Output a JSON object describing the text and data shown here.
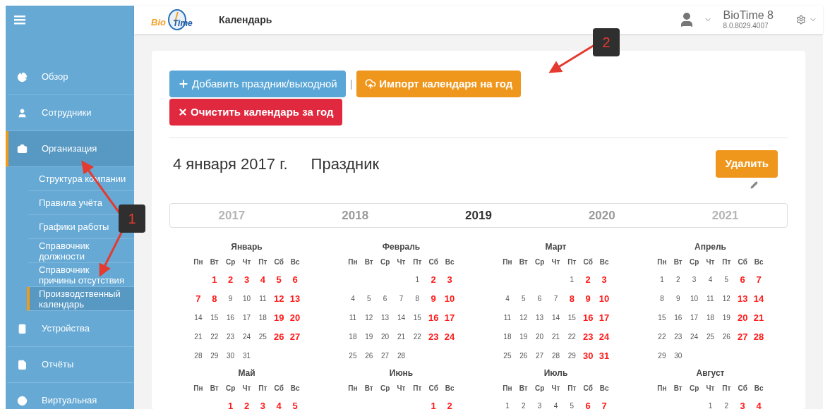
{
  "sidebar": {
    "items": [
      {
        "label": "Обзор",
        "selected": false
      },
      {
        "label": "Сотрудники",
        "selected": false
      },
      {
        "label": "Организация",
        "selected": true,
        "children": [
          {
            "label": "Структура компании",
            "selected": false
          },
          {
            "label": "Правила учёта",
            "selected": false
          },
          {
            "label": "Графики работы",
            "selected": false
          },
          {
            "label": "Справочник должности",
            "selected": false
          },
          {
            "label": "Справочник причины отсутствия",
            "selected": false
          },
          {
            "label": "Производственный календарь",
            "selected": true
          }
        ]
      },
      {
        "label": "Устройства",
        "selected": false
      },
      {
        "label": "Отчёты",
        "selected": false
      },
      {
        "label": "Виртуальная",
        "selected": false
      }
    ]
  },
  "header": {
    "logo": {
      "part1": "Bio",
      "part2": "Time"
    },
    "title": "Календарь",
    "product": "BioTime 8",
    "version": "8.0.8029.4007"
  },
  "toolbar": {
    "add_button": "Добавить праздник/выходной",
    "separator": "|",
    "import_button": "Импорт календаря на год",
    "clear_button": "Очистить календарь за год"
  },
  "event": {
    "date": "4 января 2017 г.",
    "type": "Праздник",
    "delete_button": "Удалить"
  },
  "years": [
    {
      "label": "2017",
      "selected": false,
      "faded": true
    },
    {
      "label": "2018",
      "selected": false,
      "faded": false
    },
    {
      "label": "2019",
      "selected": true,
      "faded": false
    },
    {
      "label": "2020",
      "selected": false,
      "faded": false
    },
    {
      "label": "2021",
      "selected": false,
      "faded": true
    }
  ],
  "months": [
    {
      "name": "Январь",
      "weekdays": [
        "Пн",
        "Вт",
        "Ср",
        "Чт",
        "Пт",
        "Сб",
        "Вс"
      ],
      "weeks": [
        [
          {
            "d": "1",
            "holiday": true
          },
          {
            "d": "2",
            "holiday": true
          },
          {
            "d": "3",
            "holiday": true
          },
          {
            "d": "4",
            "holiday": true
          },
          {
            "d": "5",
            "holiday": true
          },
          {
            "d": "6",
            "holiday": true
          }
        ],
        [
          {
            "d": "7",
            "holiday": true
          },
          {
            "d": "8",
            "holiday": true
          },
          {
            "d": "9",
            "holiday": false
          },
          {
            "d": "10",
            "holiday": false
          },
          {
            "d": "11",
            "holiday": false
          },
          {
            "d": "12",
            "holiday": true
          },
          {
            "d": "13",
            "holiday": true
          }
        ],
        [
          {
            "d": "14",
            "holiday": false
          },
          {
            "d": "15",
            "holiday": false
          },
          {
            "d": "16",
            "holiday": false
          },
          {
            "d": "17",
            "holiday": false
          },
          {
            "d": "18",
            "holiday": false
          },
          {
            "d": "19",
            "holiday": true
          },
          {
            "d": "20",
            "holiday": true
          }
        ],
        [
          {
            "d": "21",
            "holiday": false
          },
          {
            "d": "22",
            "holiday": false
          },
          {
            "d": "23",
            "holiday": false
          },
          {
            "d": "24",
            "holiday": false
          },
          {
            "d": "25",
            "holiday": false
          },
          {
            "d": "26",
            "holiday": true
          },
          {
            "d": "27",
            "holiday": true
          }
        ],
        [
          {
            "d": "28",
            "holiday": false
          },
          {
            "d": "29",
            "holiday": false
          },
          {
            "d": "30",
            "holiday": false
          },
          {
            "d": "31",
            "holiday": false
          }
        ]
      ]
    },
    {
      "name": "Февраль",
      "weekdays": [
        "Пн",
        "Вт",
        "Ср",
        "Чт",
        "Пт",
        "Сб",
        "Вс"
      ],
      "weeks": [
        [
          {
            "d": "1",
            "holiday": false
          },
          {
            "d": "2",
            "holiday": true
          },
          {
            "d": "3",
            "holiday": true
          }
        ],
        [
          {
            "d": "4",
            "holiday": false
          },
          {
            "d": "5",
            "holiday": false
          },
          {
            "d": "6",
            "holiday": false
          },
          {
            "d": "7",
            "holiday": false
          },
          {
            "d": "8",
            "holiday": false
          },
          {
            "d": "9",
            "holiday": true
          },
          {
            "d": "10",
            "holiday": true
          }
        ],
        [
          {
            "d": "11",
            "holiday": false
          },
          {
            "d": "12",
            "holiday": false
          },
          {
            "d": "13",
            "holiday": false
          },
          {
            "d": "14",
            "holiday": false
          },
          {
            "d": "15",
            "holiday": false
          },
          {
            "d": "16",
            "holiday": true
          },
          {
            "d": "17",
            "holiday": true
          }
        ],
        [
          {
            "d": "18",
            "holiday": false
          },
          {
            "d": "19",
            "holiday": false
          },
          {
            "d": "20",
            "holiday": false
          },
          {
            "d": "21",
            "holiday": false
          },
          {
            "d": "22",
            "holiday": false
          },
          {
            "d": "23",
            "holiday": true
          },
          {
            "d": "24",
            "holiday": true
          }
        ],
        [
          {
            "d": "25",
            "holiday": false
          },
          {
            "d": "26",
            "holiday": false
          },
          {
            "d": "27",
            "holiday": false
          },
          {
            "d": "28",
            "holiday": false
          }
        ]
      ]
    },
    {
      "name": "Март",
      "weekdays": [
        "Пн",
        "Вт",
        "Ср",
        "Чт",
        "Пт",
        "Сб",
        "Вс"
      ],
      "weeks": [
        [
          {
            "d": "1",
            "holiday": false
          },
          {
            "d": "2",
            "holiday": true
          },
          {
            "d": "3",
            "holiday": true
          }
        ],
        [
          {
            "d": "4",
            "holiday": false
          },
          {
            "d": "5",
            "holiday": false
          },
          {
            "d": "6",
            "holiday": false
          },
          {
            "d": "7",
            "holiday": false
          },
          {
            "d": "8",
            "holiday": true
          },
          {
            "d": "9",
            "holiday": true
          },
          {
            "d": "10",
            "holiday": true
          }
        ],
        [
          {
            "d": "11",
            "holiday": false
          },
          {
            "d": "12",
            "holiday": false
          },
          {
            "d": "13",
            "holiday": false
          },
          {
            "d": "14",
            "holiday": false
          },
          {
            "d": "15",
            "holiday": false
          },
          {
            "d": "16",
            "holiday": true
          },
          {
            "d": "17",
            "holiday": true
          }
        ],
        [
          {
            "d": "18",
            "holiday": false
          },
          {
            "d": "19",
            "holiday": false
          },
          {
            "d": "20",
            "holiday": false
          },
          {
            "d": "21",
            "holiday": false
          },
          {
            "d": "22",
            "holiday": false
          },
          {
            "d": "23",
            "holiday": true
          },
          {
            "d": "24",
            "holiday": true
          }
        ],
        [
          {
            "d": "25",
            "holiday": false
          },
          {
            "d": "26",
            "holiday": false
          },
          {
            "d": "27",
            "holiday": false
          },
          {
            "d": "28",
            "holiday": false
          },
          {
            "d": "29",
            "holiday": false
          },
          {
            "d": "30",
            "holiday": true
          },
          {
            "d": "31",
            "holiday": true
          }
        ]
      ]
    },
    {
      "name": "Апрель",
      "weekdays": [
        "Пн",
        "Вт",
        "Ср",
        "Чт",
        "Пт",
        "Сб",
        "Вс"
      ],
      "weeks": [
        [
          {
            "d": "1",
            "holiday": false
          },
          {
            "d": "2",
            "holiday": false
          },
          {
            "d": "3",
            "holiday": false
          },
          {
            "d": "4",
            "holiday": false
          },
          {
            "d": "5",
            "holiday": false
          },
          {
            "d": "6",
            "holiday": true
          },
          {
            "d": "7",
            "holiday": true
          }
        ],
        [
          {
            "d": "8",
            "holiday": false
          },
          {
            "d": "9",
            "holiday": false
          },
          {
            "d": "10",
            "holiday": false
          },
          {
            "d": "11",
            "holiday": false
          },
          {
            "d": "12",
            "holiday": false
          },
          {
            "d": "13",
            "holiday": true
          },
          {
            "d": "14",
            "holiday": true
          }
        ],
        [
          {
            "d": "15",
            "holiday": false
          },
          {
            "d": "16",
            "holiday": false
          },
          {
            "d": "17",
            "holiday": false
          },
          {
            "d": "18",
            "holiday": false
          },
          {
            "d": "19",
            "holiday": false
          },
          {
            "d": "20",
            "holiday": true
          },
          {
            "d": "21",
            "holiday": true
          }
        ],
        [
          {
            "d": "22",
            "holiday": false
          },
          {
            "d": "23",
            "holiday": false
          },
          {
            "d": "24",
            "holiday": false
          },
          {
            "d": "25",
            "holiday": false
          },
          {
            "d": "26",
            "holiday": false
          },
          {
            "d": "27",
            "holiday": true
          },
          {
            "d": "28",
            "holiday": true
          }
        ],
        [
          {
            "d": "29",
            "holiday": false
          },
          {
            "d": "30",
            "holiday": false
          }
        ]
      ]
    },
    {
      "name": "Май",
      "weekdays": [
        "Пн",
        "Вт",
        "Ср",
        "Чт",
        "Пт",
        "Сб",
        "Вс"
      ],
      "weeks": [
        [
          {
            "d": "1",
            "holiday": true
          },
          {
            "d": "2",
            "holiday": true
          },
          {
            "d": "3",
            "holiday": true
          },
          {
            "d": "4",
            "holiday": true
          },
          {
            "d": "5",
            "holiday": true
          }
        ]
      ]
    },
    {
      "name": "Июнь",
      "weekdays": [
        "Пн",
        "Вт",
        "Ср",
        "Чт",
        "Пт",
        "Сб",
        "Вс"
      ],
      "weeks": [
        [
          {
            "d": "1",
            "holiday": true
          },
          {
            "d": "2",
            "holiday": true
          }
        ]
      ]
    },
    {
      "name": "Июль",
      "weekdays": [
        "Пн",
        "Вт",
        "Ср",
        "Чт",
        "Пт",
        "Сб",
        "Вс"
      ],
      "weeks": [
        [
          {
            "d": "1",
            "holiday": false
          },
          {
            "d": "2",
            "holiday": false
          },
          {
            "d": "3",
            "holiday": false
          },
          {
            "d": "4",
            "holiday": false
          },
          {
            "d": "5",
            "holiday": false
          },
          {
            "d": "6",
            "holiday": true
          },
          {
            "d": "7",
            "holiday": true
          }
        ]
      ]
    },
    {
      "name": "Август",
      "weekdays": [
        "Пн",
        "Вт",
        "Ср",
        "Чт",
        "Пт",
        "Сб",
        "Вс"
      ],
      "weeks": [
        [
          {
            "d": "1",
            "holiday": false
          },
          {
            "d": "2",
            "holiday": false
          },
          {
            "d": "3",
            "holiday": true
          },
          {
            "d": "4",
            "holiday": true
          }
        ]
      ]
    }
  ],
  "annotations": [
    {
      "label": "1"
    },
    {
      "label": "2"
    }
  ]
}
